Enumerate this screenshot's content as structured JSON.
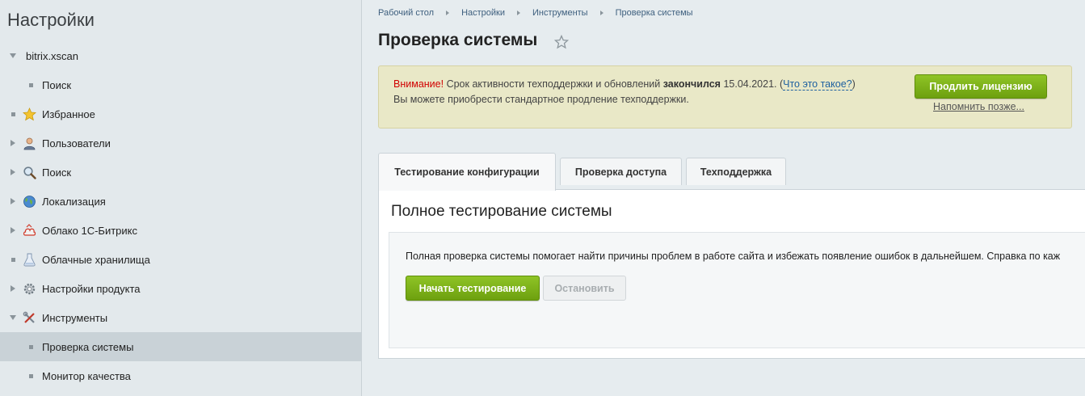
{
  "sidebar": {
    "title": "Настройки",
    "items": [
      {
        "label": "bitrix.xscan",
        "icon": "",
        "expander": "down"
      },
      {
        "label": "Поиск",
        "icon": "",
        "expander": "dot"
      },
      {
        "label": "Избранное",
        "icon": "star-icon",
        "expander": "dot"
      },
      {
        "label": "Пользователи",
        "icon": "user-icon",
        "expander": "right"
      },
      {
        "label": "Поиск",
        "icon": "magnifier-icon",
        "expander": "right"
      },
      {
        "label": "Локализация",
        "icon": "globe-icon",
        "expander": "right"
      },
      {
        "label": "Облако 1С-Битрикс",
        "icon": "cloud-icon",
        "expander": "right"
      },
      {
        "label": "Облачные хранилища",
        "icon": "storage-icon",
        "expander": "dot"
      },
      {
        "label": "Настройки продукта",
        "icon": "gear-icon",
        "expander": "right"
      },
      {
        "label": "Инструменты",
        "icon": "tools-icon",
        "expander": "down"
      },
      {
        "label": "Проверка системы",
        "icon": "",
        "expander": "dot"
      },
      {
        "label": "Монитор качества",
        "icon": "",
        "expander": "dot"
      }
    ]
  },
  "breadcrumb": [
    "Рабочий стол",
    "Настройки",
    "Инструменты",
    "Проверка системы"
  ],
  "page_title": "Проверка системы",
  "notice": {
    "warning": "Внимание!",
    "text1": " Срок активности техподдержки и обновлений ",
    "bold": "закончился",
    "date": " 15.04.2021. (",
    "link": "Что это такое?",
    "close_paren": ")",
    "text2": "Вы можете приобрести стандартное продление техподдержки.",
    "renew_button": "Продлить лицензию",
    "remind_link": "Напомнить позже..."
  },
  "tabs": [
    "Тестирование конфигурации",
    "Проверка доступа",
    "Техподдержка"
  ],
  "panel": {
    "title": "Полное тестирование системы",
    "description": "Полная проверка системы помогает найти причины проблем в работе сайта и избежать появление ошибок в дальнейшем. Справка по каж",
    "start_button": "Начать тестирование",
    "stop_button": "Остановить"
  },
  "colors": {
    "accent_green": "#7ab51d",
    "warning_red": "#d10000",
    "link_blue": "#1f61a0",
    "notice_bg": "#e9e8c7"
  }
}
